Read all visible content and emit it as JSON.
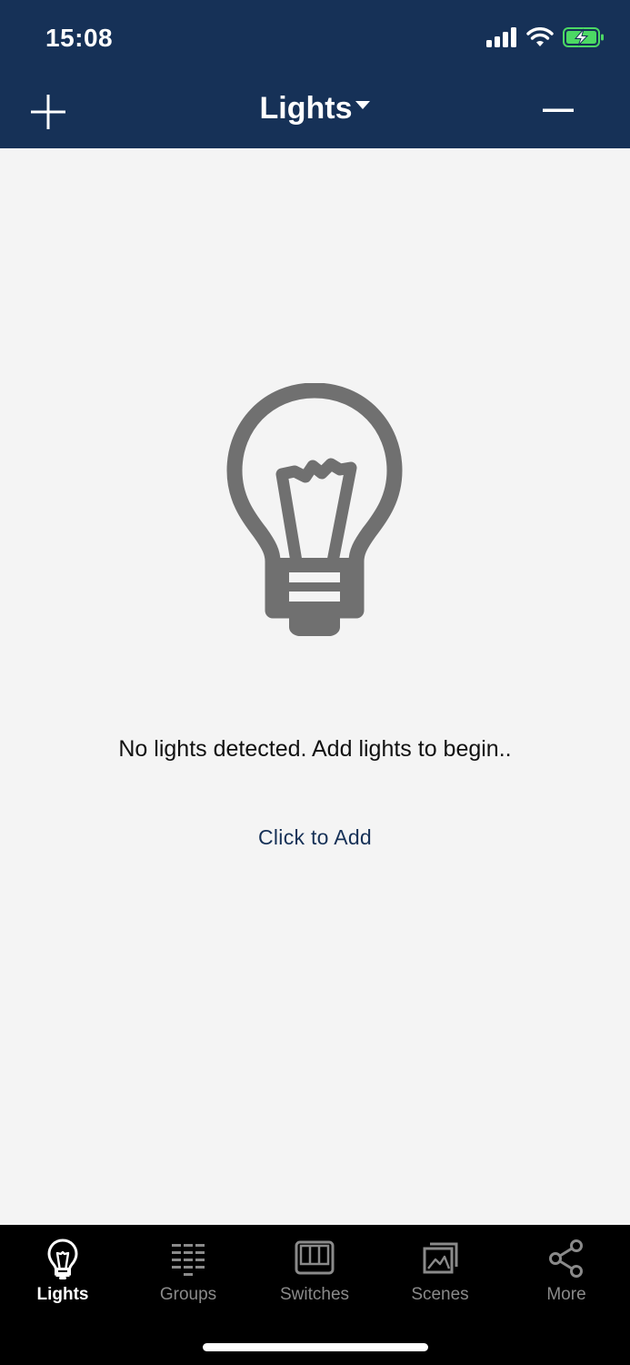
{
  "status_bar": {
    "time": "15:08"
  },
  "nav": {
    "title": "Lights",
    "add_icon": "plus-icon",
    "remove_icon": "minus-icon"
  },
  "empty_state": {
    "icon": "lightbulb-icon",
    "message": "No lights detected. Add lights to begin..",
    "action": "Click to Add"
  },
  "tabbar": {
    "active": "Lights",
    "tabs": [
      {
        "label": "Lights",
        "icon": "lightbulb-icon"
      },
      {
        "label": "Groups",
        "icon": "groups-icon"
      },
      {
        "label": "Switches",
        "icon": "switches-icon"
      },
      {
        "label": "Scenes",
        "icon": "scenes-icon"
      },
      {
        "label": "More",
        "icon": "share-icon"
      }
    ]
  },
  "colors": {
    "header_bg": "#163157",
    "accent": "#163157",
    "background": "#f4f4f4",
    "tabbar_bg": "#000000",
    "battery_green": "#4cd964",
    "icon_gray": "#707070"
  }
}
